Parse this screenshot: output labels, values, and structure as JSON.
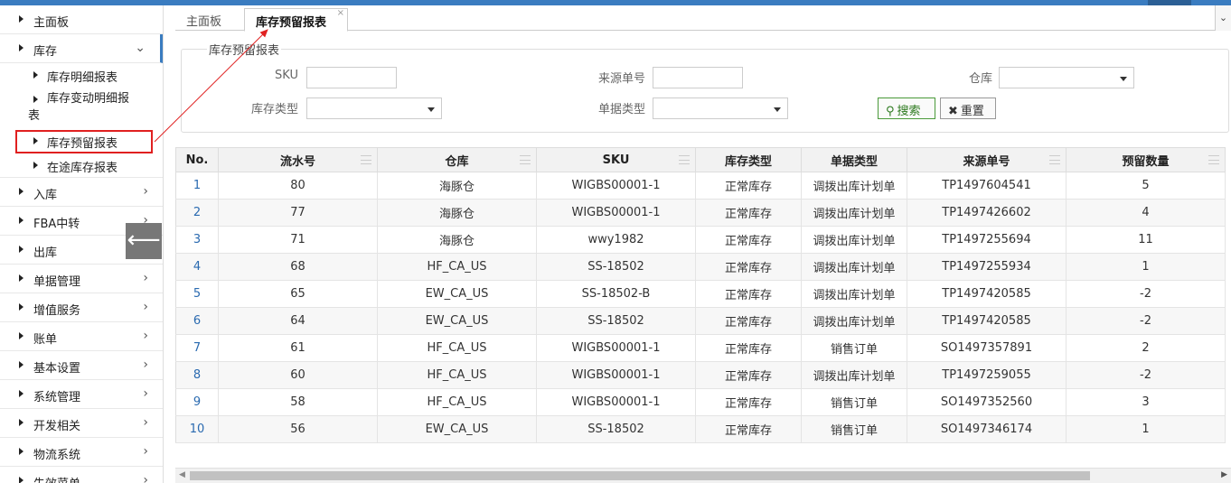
{
  "sidebar": {
    "items": [
      {
        "label": "主面板",
        "chevron": ""
      },
      {
        "label": "库存",
        "chevron": "⌄"
      },
      {
        "label": "入库",
        "chevron": "›"
      },
      {
        "label": "FBA中转",
        "chevron": "›"
      },
      {
        "label": "出库",
        "chevron": "›"
      },
      {
        "label": "单据管理",
        "chevron": "›"
      },
      {
        "label": "增值服务",
        "chevron": "›"
      },
      {
        "label": "账单",
        "chevron": "›"
      },
      {
        "label": "基本设置",
        "chevron": "›"
      },
      {
        "label": "系统管理",
        "chevron": "›"
      },
      {
        "label": "开发相关",
        "chevron": "›"
      },
      {
        "label": "物流系统",
        "chevron": "›"
      },
      {
        "label": "失效菜单",
        "chevron": "›"
      }
    ],
    "sub_items": [
      {
        "label": "库存明细报表"
      },
      {
        "label_line1": "库存变动明细报",
        "label_line2": "表"
      },
      {
        "label": "库存预留报表"
      },
      {
        "label": "在途库存报表"
      }
    ],
    "collapse_icon": "arrow-left-icon",
    "collapse_glyph": "⟵"
  },
  "tabs": [
    {
      "label": "主面板"
    },
    {
      "label": "库存预留报表",
      "close": "×"
    }
  ],
  "tab_dropdown_glyph": "⌄",
  "search": {
    "legend": "库存预留报表",
    "sku_label": "SKU",
    "source_no_label": "来源单号",
    "warehouse_label": "仓库",
    "stock_type_label": "库存类型",
    "doc_type_label": "单据类型",
    "search_btn": "搜索",
    "reset_btn": "重置",
    "search_icon": "search-icon",
    "reset_icon": "x-icon"
  },
  "table": {
    "headers": [
      "No.",
      "流水号",
      "仓库",
      "SKU",
      "库存类型",
      "单据类型",
      "来源单号",
      "预留数量"
    ],
    "rows": [
      [
        "1",
        "80",
        "海豚仓",
        "WIGBS00001-1",
        "正常库存",
        "调拨出库计划单",
        "TP1497604541",
        "5"
      ],
      [
        "2",
        "77",
        "海豚仓",
        "WIGBS00001-1",
        "正常库存",
        "调拨出库计划单",
        "TP1497426602",
        "4"
      ],
      [
        "3",
        "71",
        "海豚仓",
        "wwy1982",
        "正常库存",
        "调拨出库计划单",
        "TP1497255694",
        "11"
      ],
      [
        "4",
        "68",
        "HF_CA_US",
        "SS-18502",
        "正常库存",
        "调拨出库计划单",
        "TP1497255934",
        "1"
      ],
      [
        "5",
        "65",
        "EW_CA_US",
        "SS-18502-B",
        "正常库存",
        "调拨出库计划单",
        "TP1497420585",
        "-2"
      ],
      [
        "6",
        "64",
        "EW_CA_US",
        "SS-18502",
        "正常库存",
        "调拨出库计划单",
        "TP1497420585",
        "-2"
      ],
      [
        "7",
        "61",
        "HF_CA_US",
        "WIGBS00001-1",
        "正常库存",
        "销售订单",
        "SO1497357891",
        "2"
      ],
      [
        "8",
        "60",
        "HF_CA_US",
        "WIGBS00001-1",
        "正常库存",
        "调拨出库计划单",
        "TP1497259055",
        "-2"
      ],
      [
        "9",
        "58",
        "HF_CA_US",
        "WIGBS00001-1",
        "正常库存",
        "销售订单",
        "SO1497352560",
        "3"
      ],
      [
        "10",
        "56",
        "EW_CA_US",
        "SS-18502",
        "正常库存",
        "销售订单",
        "SO1497346174",
        "1"
      ]
    ]
  },
  "colors": {
    "accent": "#3a7cc0",
    "annotation": "#e02020",
    "search_green": "#2d7a1f"
  }
}
